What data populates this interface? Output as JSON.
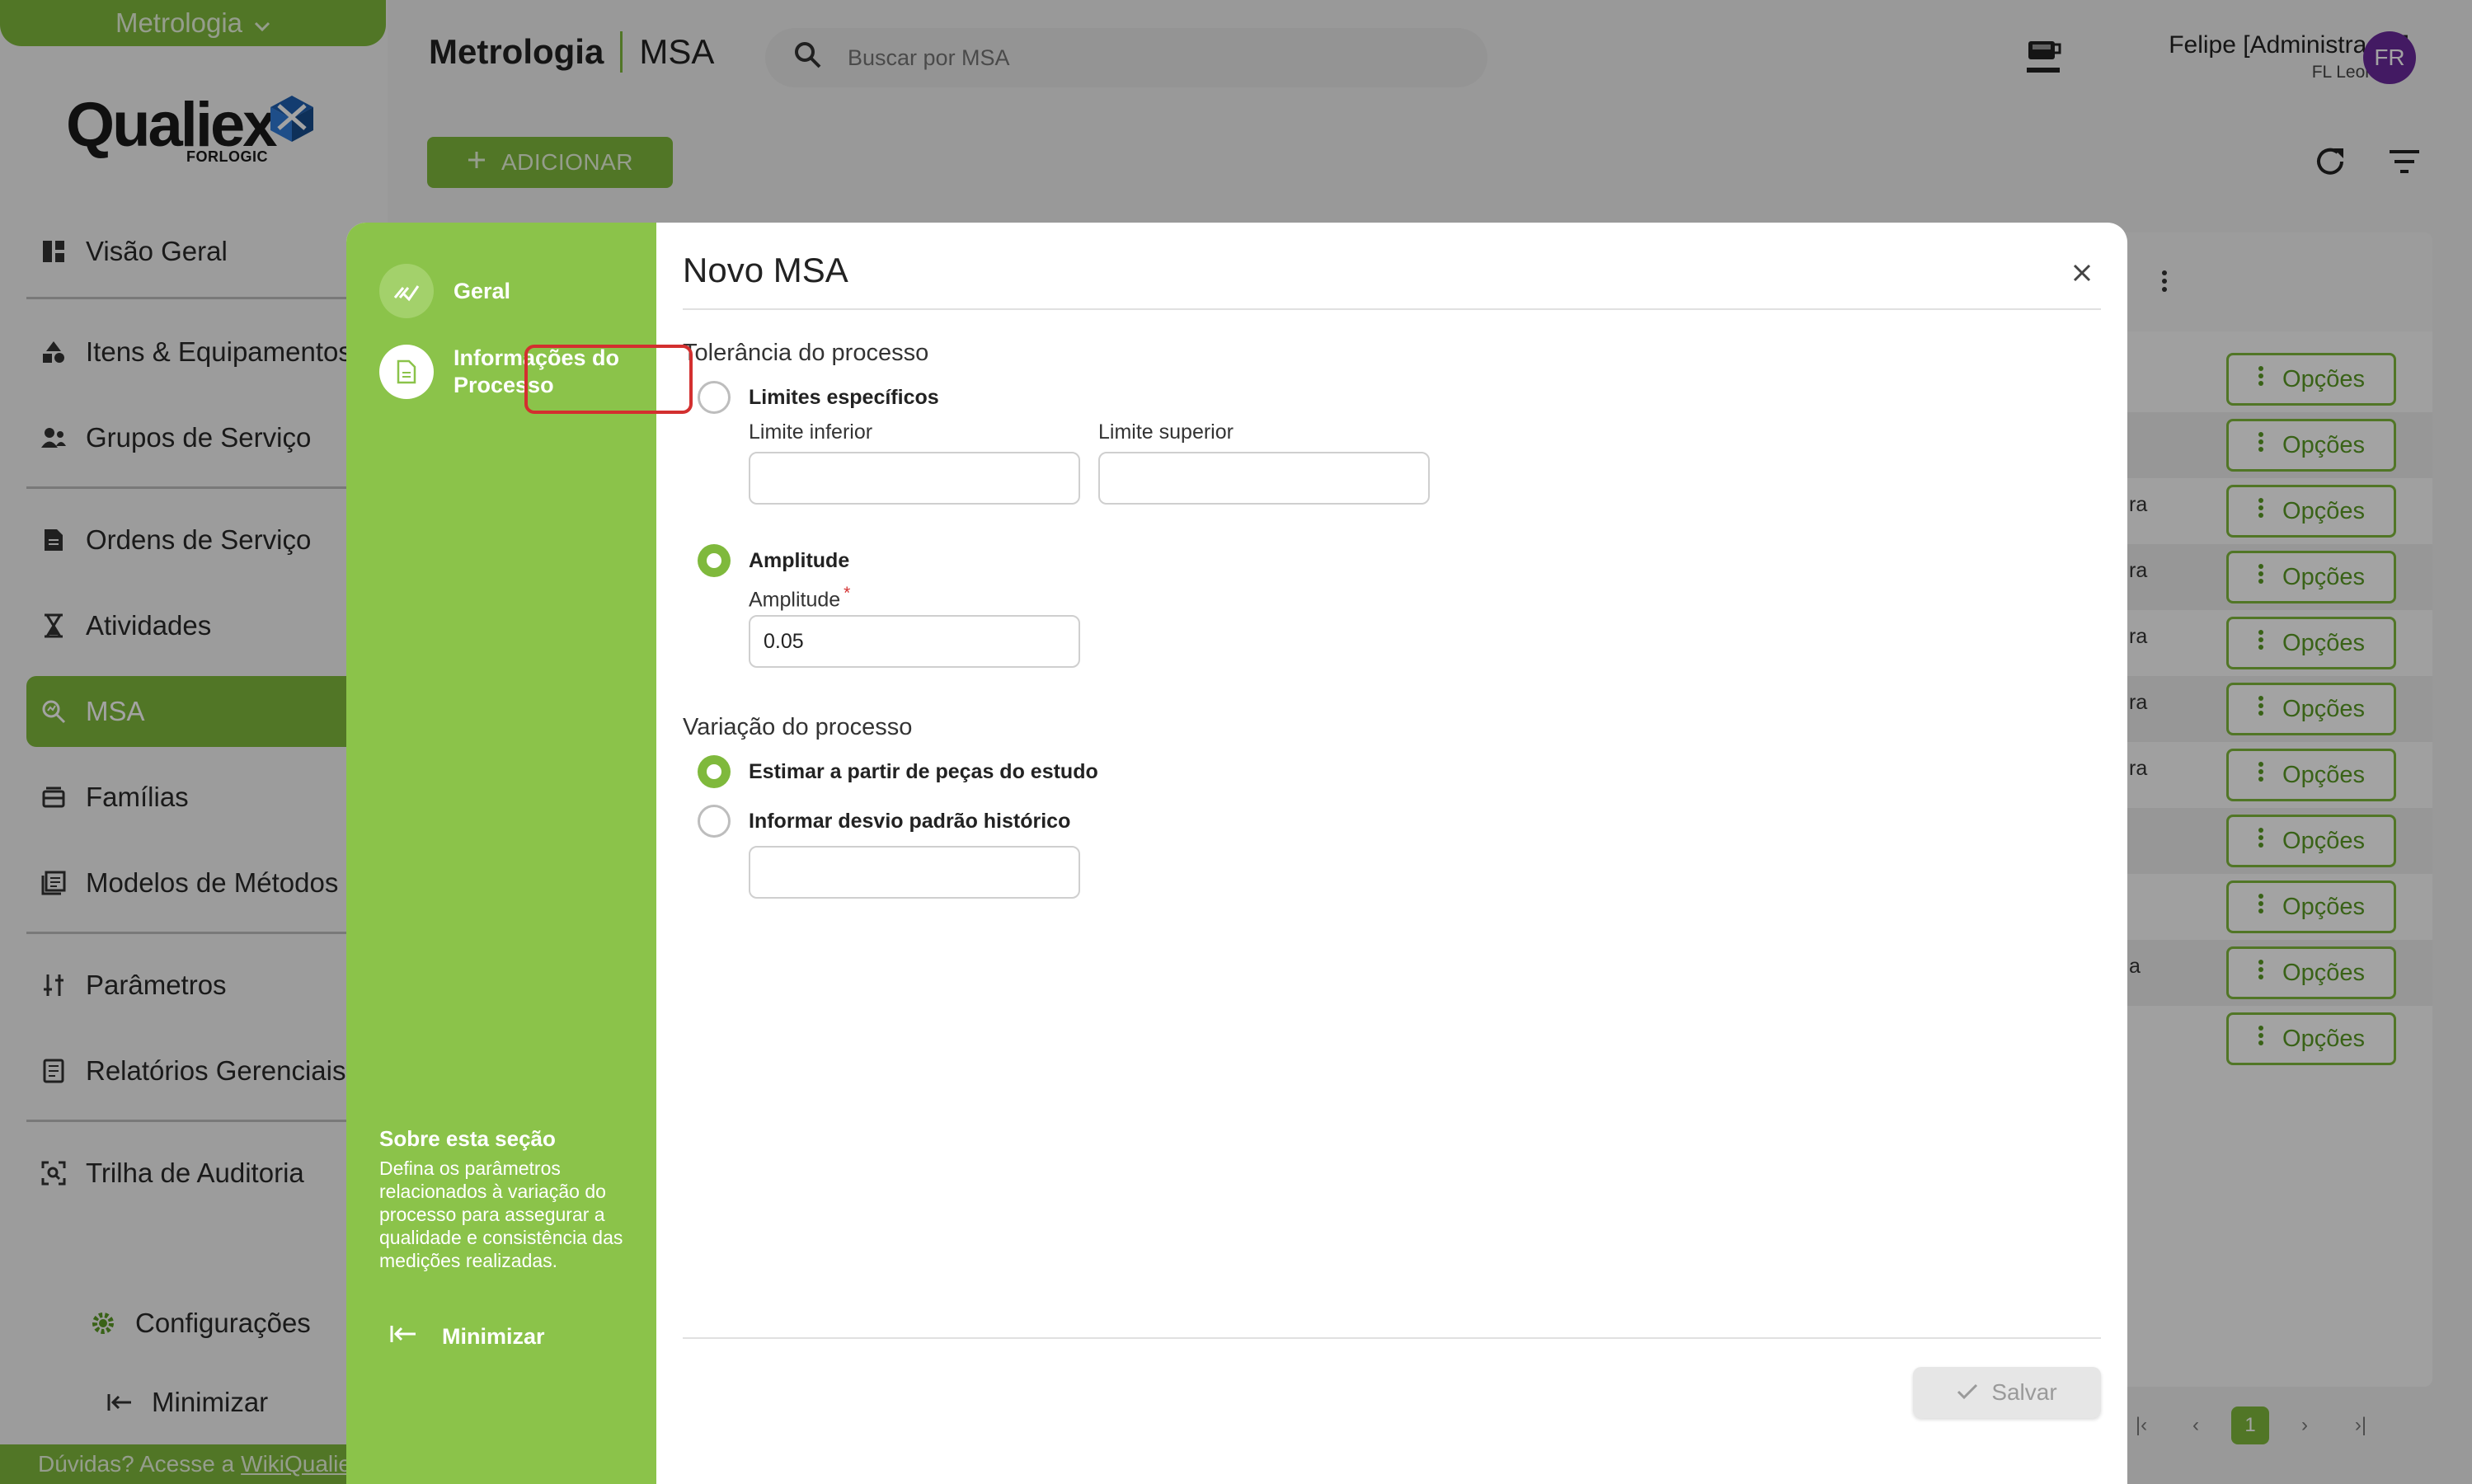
{
  "sidebar": {
    "module": "Metrologia",
    "logo_word": "Qualiex",
    "logo_sub": "FORLOGIC",
    "items": [
      {
        "label": "Visão Geral",
        "icon": "dashboard-icon"
      },
      {
        "label": "Itens & Equipamentos",
        "icon": "shapes-icon"
      },
      {
        "label": "Grupos de Serviço",
        "icon": "group-icon"
      },
      {
        "label": "Ordens de Serviço",
        "icon": "document-icon"
      },
      {
        "label": "Atividades",
        "icon": "hourglass-icon"
      },
      {
        "label": "MSA",
        "icon": "search-chart-icon"
      },
      {
        "label": "Famílias",
        "icon": "stack-icon"
      },
      {
        "label": "Modelos de Métodos",
        "icon": "list-icon"
      },
      {
        "label": "Parâmetros",
        "icon": "sliders-icon"
      },
      {
        "label": "Relatórios Gerenciais",
        "icon": "report-icon"
      },
      {
        "label": "Trilha de Auditoria",
        "icon": "audit-icon"
      }
    ],
    "settings_label": "Configurações",
    "minimize_label": "Minimizar",
    "footer_text": "Dúvidas? Acesse a",
    "footer_link": "WikiQualiex"
  },
  "header": {
    "app": "Metrologia",
    "page": "MSA",
    "search_placeholder": "Buscar por MSA",
    "user_name": "Felipe [Administrador]",
    "user_company": "FL Leonardo",
    "avatar_initials": "FR"
  },
  "toolbar": {
    "add_label": "ADICIONAR"
  },
  "table": {
    "option_label": "Opções",
    "row_fragments": [
      "",
      "",
      "ra",
      "ra",
      "ra",
      "ra",
      "ra",
      "",
      "",
      "a",
      ""
    ],
    "current_page": "1"
  },
  "modal": {
    "title": "Novo MSA",
    "steps": [
      {
        "label": "Geral",
        "state": "done"
      },
      {
        "label": "Informações do Processo",
        "state": "current"
      }
    ],
    "about_title": "Sobre esta seção",
    "about_text": "Defina os parâmetros relacionados à variação do processo para assegurar a qualidade e consistência das medições realizadas.",
    "minimize_label": "Minimizar",
    "tolerance": {
      "title": "Tolerância do processo",
      "option_specific": "Limites específicos",
      "lower_label": "Limite inferior",
      "lower_value": "",
      "upper_label": "Limite superior",
      "upper_value": "",
      "option_amplitude": "Amplitude",
      "amplitude_label": "Amplitude",
      "required_mark": "*",
      "amplitude_value": "0.05",
      "selected": "amplitude"
    },
    "variation": {
      "title": "Variação do processo",
      "option_estimate": "Estimar a partir de peças do estudo",
      "option_historic": "Informar desvio padrão histórico",
      "historic_value": "",
      "selected": "estimate"
    },
    "save_label": "Salvar"
  },
  "colors": {
    "brand_green": "#7fb93c",
    "modal_side_green": "#8bc34a",
    "highlight_red": "#d32f2f",
    "avatar_purple": "#6a2a9c"
  }
}
